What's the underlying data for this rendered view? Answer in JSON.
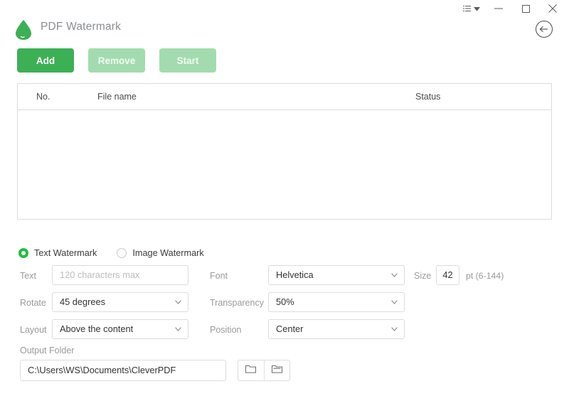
{
  "window": {
    "controls": [
      {
        "name": "list-view-dropdown",
        "icon": "list-caret-icon"
      },
      {
        "name": "minimize",
        "icon": "minimize-icon"
      },
      {
        "name": "maximize",
        "icon": "maximize-icon"
      },
      {
        "name": "close",
        "icon": "close-icon"
      }
    ]
  },
  "header": {
    "title": "PDF Watermark",
    "logo_icon": "droplet-icon",
    "back_icon": "back-arrow-circle-icon"
  },
  "toolbar": {
    "add_label": "Add",
    "remove_label": "Remove",
    "start_label": "Start"
  },
  "file_table": {
    "columns": [
      "No.",
      "File name",
      "Status"
    ],
    "rows": []
  },
  "watermark_type": {
    "text_label": "Text Watermark",
    "image_label": "Image Watermark",
    "selected": "text"
  },
  "form": {
    "text": {
      "label": "Text",
      "value": "",
      "placeholder": "120 characters max"
    },
    "font": {
      "label": "Font",
      "value": "Helvetica"
    },
    "size": {
      "label": "Size",
      "value": "42",
      "hint": "pt (6-144)"
    },
    "rotate": {
      "label": "Rotate",
      "value": "45 degrees"
    },
    "transparency": {
      "label": "Transparency",
      "value": "50%"
    },
    "layout": {
      "label": "Layout",
      "value": "Above the content"
    },
    "position": {
      "label": "Position",
      "value": "Center"
    }
  },
  "output": {
    "label": "Output Folder",
    "path": "C:\\Users\\WS\\Documents\\CleverPDF",
    "browse_icon": "folder-closed-icon",
    "open_icon": "folder-open-icon"
  },
  "colors": {
    "accent": "#3cb054",
    "accent_disabled": "#a2dcae",
    "radio_on": "#22c03c",
    "border": "#dcdcdc",
    "label_gray": "#9a9a9a"
  }
}
